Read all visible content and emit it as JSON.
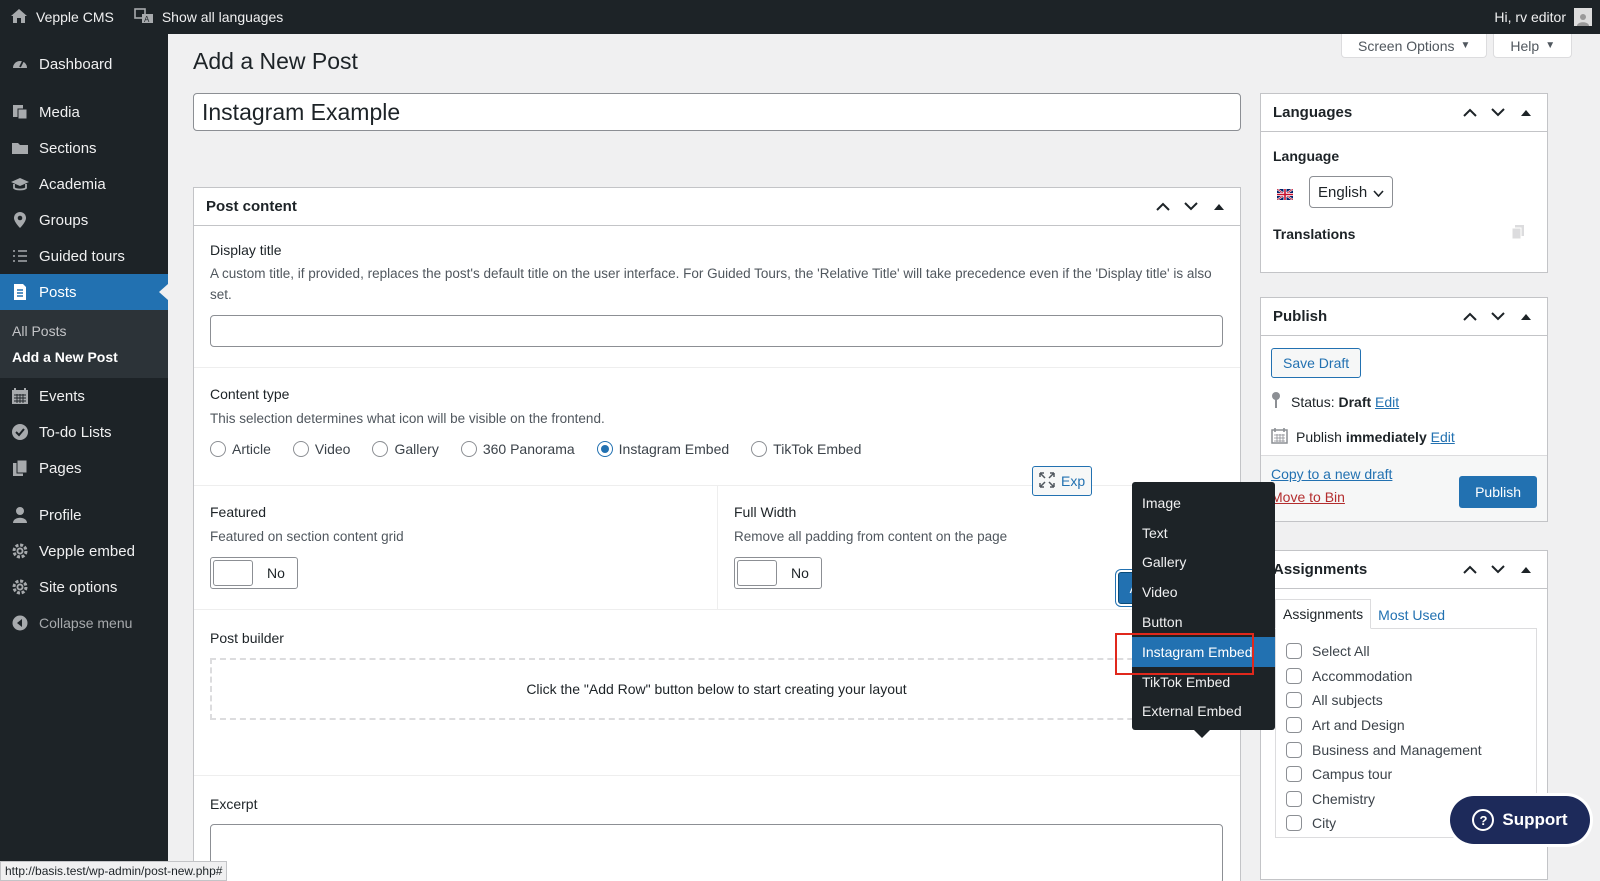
{
  "adminbar": {
    "site_name": "Vepple CMS",
    "languages": "Show all languages",
    "greeting": "Hi, rv editor"
  },
  "sidebar": {
    "items": [
      {
        "label": "Dashboard",
        "icon": "dashboard-icon"
      },
      {
        "label": "Media",
        "icon": "media-icon"
      },
      {
        "label": "Sections",
        "icon": "folder-icon"
      },
      {
        "label": "Academia",
        "icon": "graduation-cap-icon"
      },
      {
        "label": "Groups",
        "icon": "location-pin-icon"
      },
      {
        "label": "Guided tours",
        "icon": "list-icon"
      },
      {
        "label": "Posts",
        "icon": "posts-icon"
      },
      {
        "label": "Events",
        "icon": "calendar-icon"
      },
      {
        "label": "To-do Lists",
        "icon": "check-circle-icon"
      },
      {
        "label": "Pages",
        "icon": "pages-icon"
      },
      {
        "label": "Profile",
        "icon": "user-icon"
      },
      {
        "label": "Vepple embed",
        "icon": "gear-icon"
      },
      {
        "label": "Site options",
        "icon": "gear-icon"
      },
      {
        "label": "Collapse menu",
        "icon": "collapse-icon"
      }
    ],
    "submenu": [
      "All Posts",
      "Add a New Post"
    ]
  },
  "screen_meta": {
    "screen_options": "Screen Options",
    "help": "Help"
  },
  "page": {
    "title": "Add a New Post",
    "post_title": "Instagram Example"
  },
  "post_content": {
    "heading": "Post content",
    "display_title": {
      "label": "Display title",
      "desc": "A custom title, if provided, replaces the post's default title on the user interface. For Guided Tours, the 'Relative Title' will take precedence even if the 'Display title' is also set."
    },
    "content_type": {
      "label": "Content type",
      "desc": "This selection determines what icon will be visible on the frontend.",
      "options": [
        "Article",
        "Video",
        "Gallery",
        "360 Panorama",
        "Instagram Embed",
        "TikTok Embed"
      ],
      "selected": "Instagram Embed"
    },
    "featured": {
      "label": "Featured",
      "desc": "Featured on section content grid",
      "value": "No"
    },
    "full_width": {
      "label": "Full Width",
      "desc": "Remove all padding from content on the page",
      "value": "No"
    },
    "post_builder": {
      "label": "Post builder",
      "placeholder": "Click the \"Add Row\" button below to start creating your layout",
      "expand": "Exp",
      "add_row": "Add Row"
    },
    "excerpt": {
      "label": "Excerpt"
    }
  },
  "row_menu": {
    "items": [
      "Image",
      "Text",
      "Gallery",
      "Video",
      "Button",
      "Instagram Embed",
      "TikTok Embed",
      "External Embed"
    ],
    "highlighted": "Instagram Embed"
  },
  "languages_box": {
    "heading": "Languages",
    "language_label": "Language",
    "language_value": "English",
    "translations_label": "Translations"
  },
  "publish_box": {
    "heading": "Publish",
    "save_draft": "Save Draft",
    "status_label": "Status:",
    "status_value": "Draft",
    "edit": "Edit",
    "publish_label": "Publish",
    "publish_value": "immediately",
    "copy_draft": "Copy to a new draft",
    "move_to_bin": "Move to Bin",
    "publish_button": "Publish"
  },
  "assignments_box": {
    "heading": "Assignments",
    "tabs": [
      "Assignments",
      "Most Used"
    ],
    "items": [
      "Select All",
      "Accommodation",
      "All subjects",
      "Art and Design",
      "Business and Management",
      "Campus tour",
      "Chemistry",
      "City"
    ]
  },
  "support": {
    "label": "Support"
  },
  "statusbar": {
    "url": "http://basis.test/wp-admin/post-new.php#"
  }
}
